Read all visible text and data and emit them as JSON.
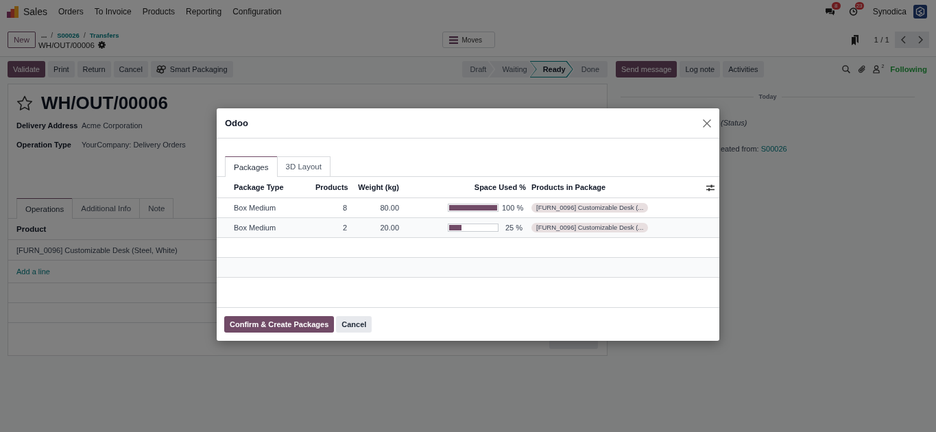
{
  "navbar": {
    "app_name": "Sales",
    "menu": [
      {
        "label": "Orders"
      },
      {
        "label": "To Invoice"
      },
      {
        "label": "Products"
      },
      {
        "label": "Reporting"
      },
      {
        "label": "Configuration"
      }
    ],
    "systray": [
      {
        "kind": "messages",
        "count": "8"
      },
      {
        "kind": "activities",
        "count": "23"
      }
    ],
    "company": "Synodica"
  },
  "control_panel": {
    "new_button": "New",
    "breadcrumbs": [
      {
        "label": "...",
        "kind": "more"
      },
      {
        "separator": "/",
        "label": "S00026",
        "kind": "link"
      },
      {
        "separator": "/",
        "label": "Transfers",
        "kind": "link"
      }
    ],
    "record_name": "WH/OUT/00006",
    "moves_button": "Moves",
    "pager": "1 / 1"
  },
  "action_buttons": [
    {
      "label": "Validate",
      "kind": "primary"
    },
    {
      "label": "Print",
      "kind": "secondary"
    },
    {
      "label": "Return",
      "kind": "secondary"
    },
    {
      "label": "Cancel",
      "kind": "secondary"
    },
    {
      "label": "Smart Packaging",
      "kind": "packaging"
    }
  ],
  "status_steps": [
    {
      "label": "Draft",
      "selected": false
    },
    {
      "label": "Waiting",
      "selected": false
    },
    {
      "label": "Ready",
      "selected": true
    },
    {
      "label": "Done",
      "selected": false
    }
  ],
  "form": {
    "favorite": false,
    "title": "WH/OUT/00006",
    "fields": [
      {
        "label": "Delivery Address",
        "value": "Acme Corporation"
      },
      {
        "label": "Operation Type",
        "value": "YourCompany: Delivery Orders"
      }
    ],
    "tabs": [
      {
        "label": "Operations",
        "selected": true
      },
      {
        "label": "Additional Info",
        "selected": false
      },
      {
        "label": "Note",
        "selected": false
      }
    ],
    "lines": {
      "columns": [
        "Product"
      ],
      "rows": [
        "[FURN_0096] Customizable Desk (Steel, White)"
      ],
      "add_line": "Add a line"
    }
  },
  "chatter": {
    "buttons": [
      {
        "label": "Send message",
        "kind": "primary"
      },
      {
        "label": "Log note",
        "kind": "secondary"
      },
      {
        "label": "Activities",
        "kind": "secondary"
      }
    ],
    "followers_count": "2",
    "follow_label": "Following",
    "date_separator": "Today",
    "messages": [
      {
        "kind": "tracking",
        "text": "(Status)"
      },
      {
        "kind": "note",
        "text": "eated from:",
        "link": "S00026"
      }
    ]
  },
  "dialog": {
    "title": "Odoo",
    "tabs": [
      {
        "label": "Packages",
        "selected": true
      },
      {
        "label": "3D Layout",
        "selected": false
      }
    ],
    "columns": [
      "Package Type",
      "Products",
      "Weight (kg)",
      "Space Used %",
      "Products in Package"
    ],
    "rows": [
      {
        "package_type": "Box Medium",
        "products": "8",
        "weight": "80.00",
        "space_used": {
          "level": 1,
          "reading": "100 %"
        },
        "products_in_package": [
          "[FURN_0096] Customizable Desk (..."
        ]
      },
      {
        "package_type": "Box Medium",
        "products": "2",
        "weight": "20.00",
        "space_used": {
          "level": 0.25,
          "reading": "25 %"
        },
        "products_in_package": [
          "[FURN_0096] Customizable Desk (..."
        ]
      }
    ],
    "footer_buttons": [
      {
        "label": "Confirm & Create Packages",
        "kind": "primary"
      },
      {
        "label": "Cancel",
        "kind": "secondary"
      }
    ]
  }
}
